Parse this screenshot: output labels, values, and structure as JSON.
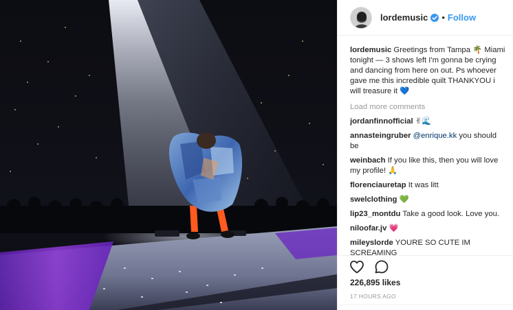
{
  "post": {
    "username": "lordemusic",
    "follow_label": "Follow",
    "separator": "•",
    "verified": true,
    "photo_alt": "",
    "caption": {
      "username": "lordemusic",
      "text": "Greetings from Tampa 🌴 Miami tonight — 3 shows left I'm gonna be crying and dancing from here on out. Ps whoever gave me this incredible quilt THANKYOU i will treasure it 💙"
    },
    "load_more_label": "Load more comments",
    "comments": [
      {
        "username": "jordanfinnofficial",
        "mention": "",
        "text": "✌🌊"
      },
      {
        "username": "annasteingruber",
        "mention": "@enrique.kk",
        "text": " you should be"
      },
      {
        "username": "weinbach",
        "mention": "",
        "text": "If you like this, then you will love my profile! 🙏"
      },
      {
        "username": "florenciauretap",
        "mention": "",
        "text": "It was litt"
      },
      {
        "username": "swelclothing",
        "mention": "",
        "text": "💚"
      },
      {
        "username": "lip23_montdu",
        "mention": "",
        "text": "Take a good look. Love you."
      },
      {
        "username": "niloofar.jv",
        "mention": "",
        "text": "💗"
      },
      {
        "username": "mileyslorde",
        "mention": "",
        "text": "YOURE SO CUTE IM SCREAMING"
      }
    ],
    "likes": "226,895 likes",
    "timestamp": "17 HOURS AGO",
    "icons": {
      "like": "heart-outline-icon",
      "comment": "speech-bubble-icon",
      "verified": "verified-badge-icon"
    },
    "colors": {
      "link": "#3897f0",
      "mention": "#003569",
      "muted": "#999999",
      "text": "#262626",
      "border": "#efefef"
    }
  }
}
